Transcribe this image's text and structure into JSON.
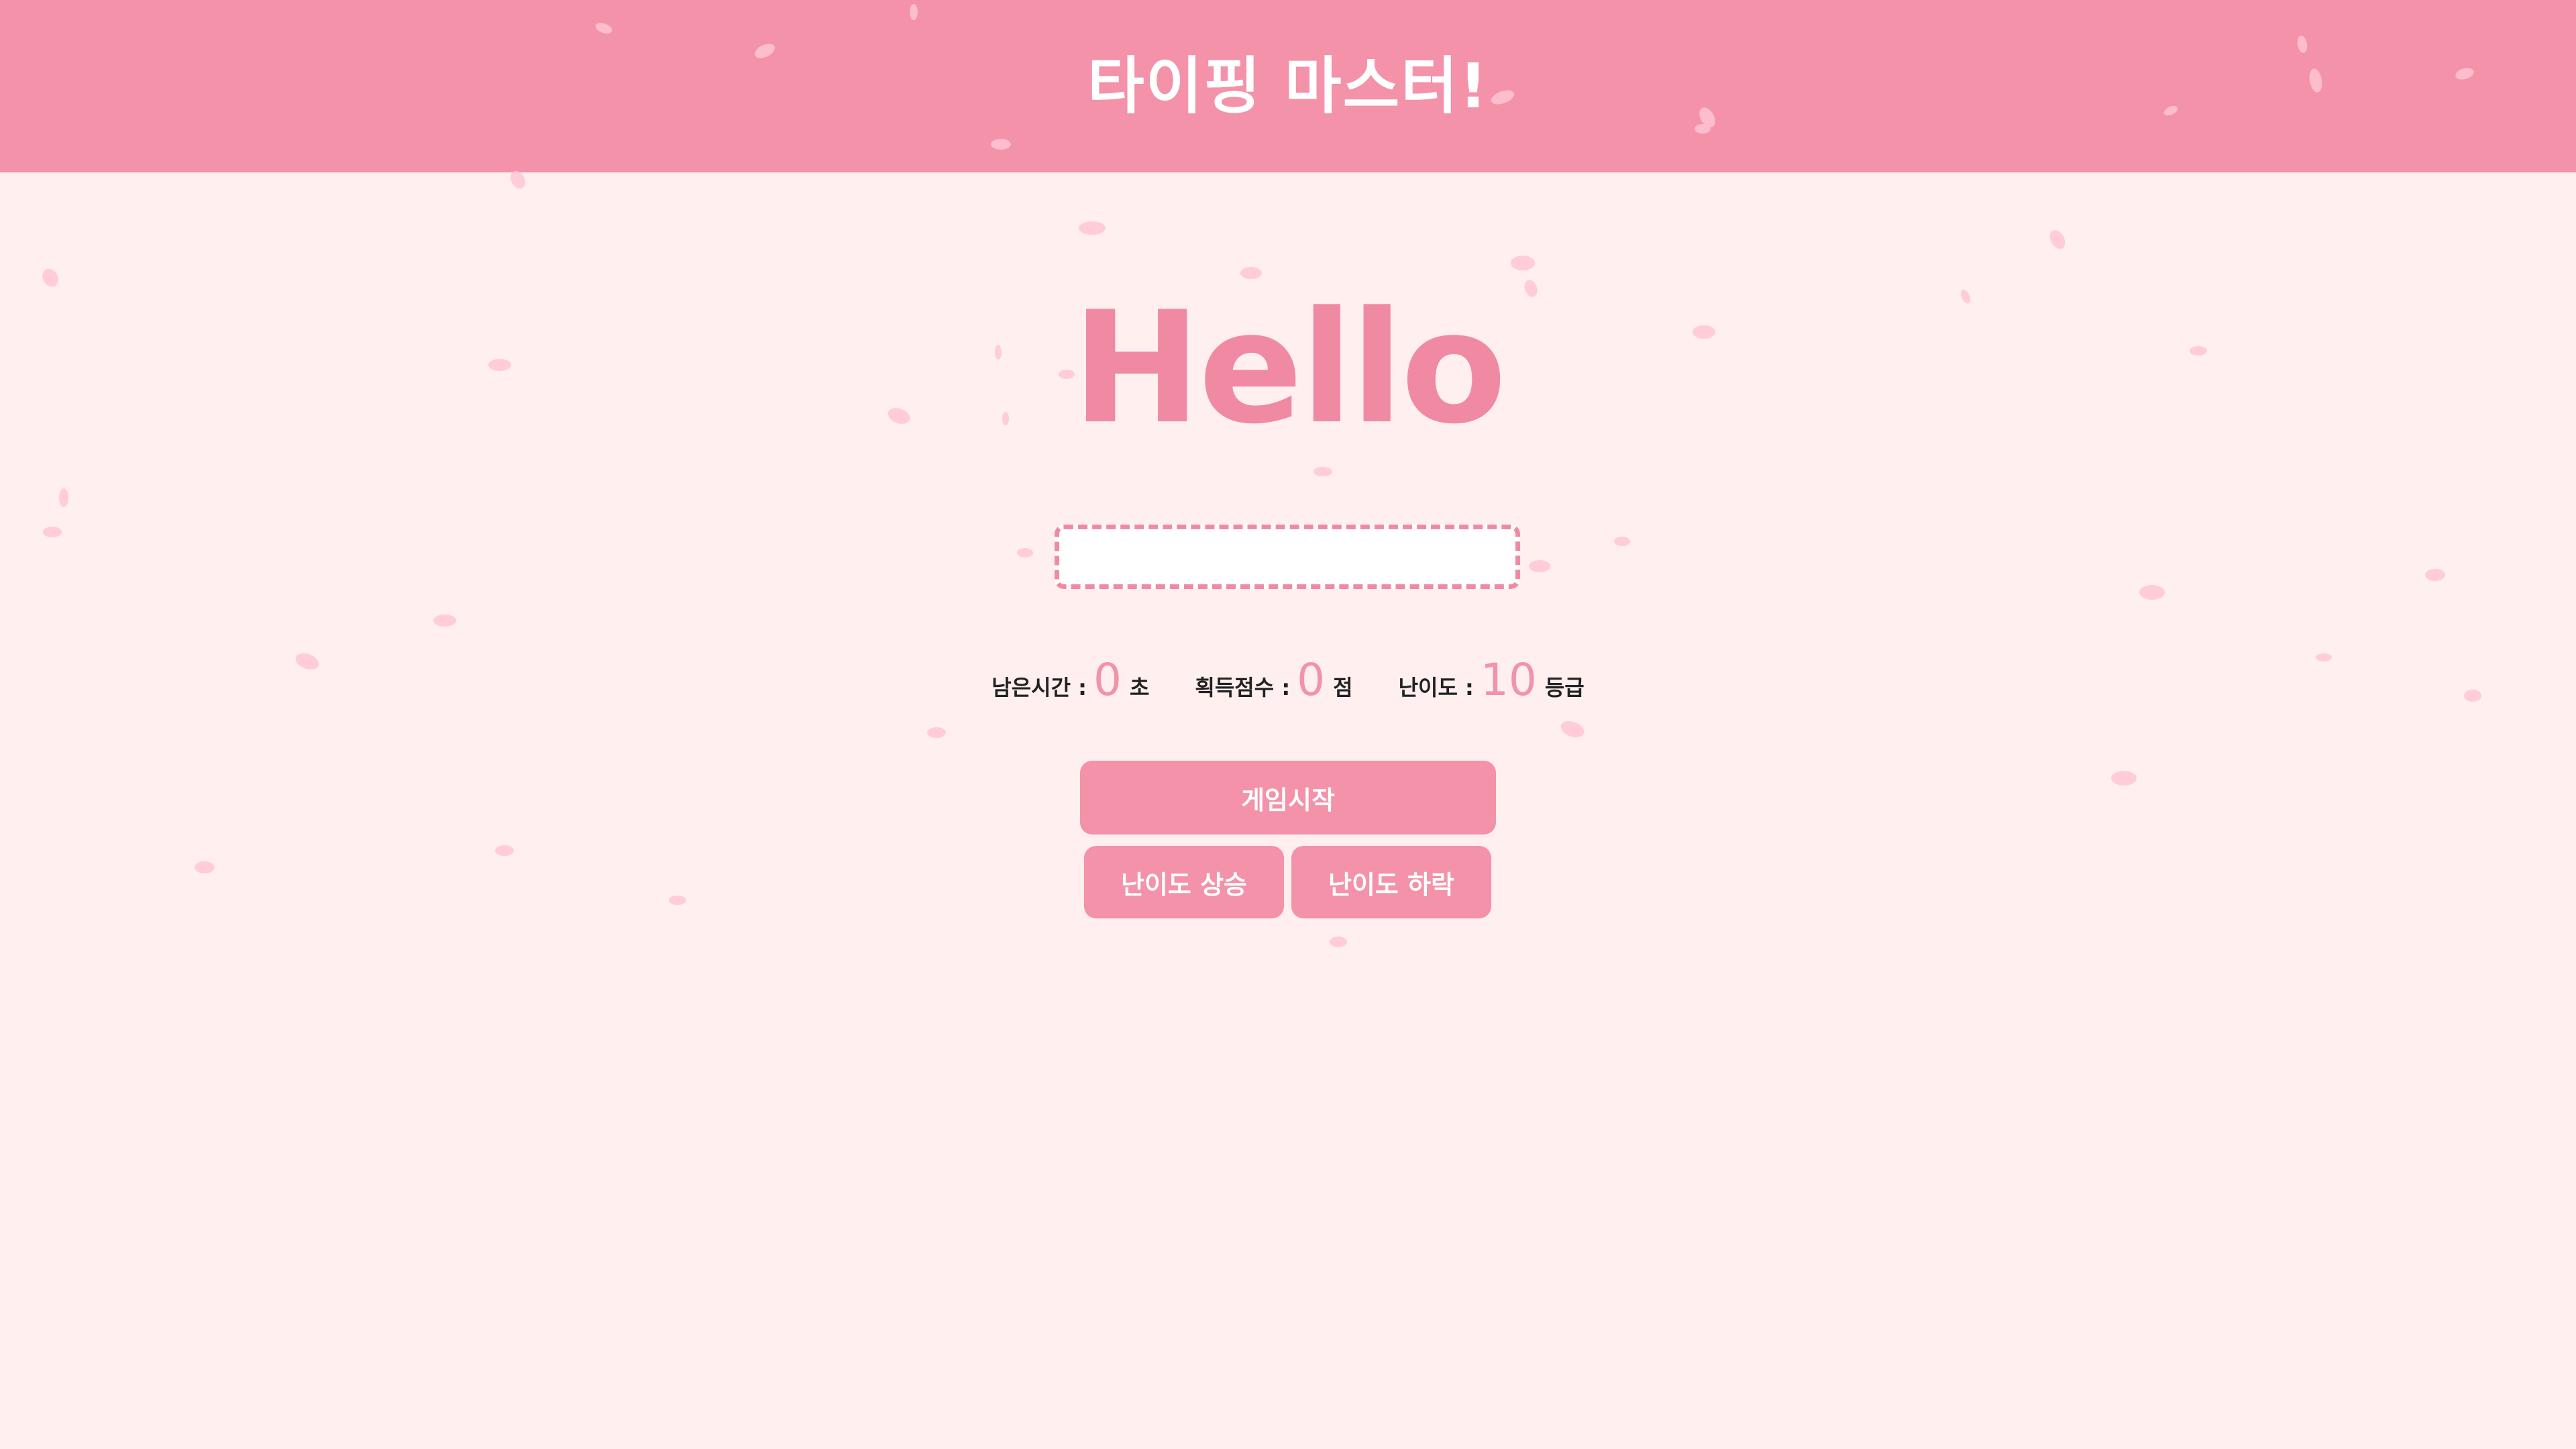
{
  "header": {
    "title": "타이핑 마스터!"
  },
  "game": {
    "current_word": "Hello",
    "input_value": ""
  },
  "stats": {
    "time_label": "남은시간 :",
    "time_value": "0",
    "time_unit": "초",
    "score_label": "획득점수 :",
    "score_value": "0",
    "score_unit": "점",
    "level_label": "난이도 :",
    "level_value": "10",
    "level_unit": "등급"
  },
  "buttons": {
    "start_label": "게임시작",
    "level_up_label": "난이도 상승",
    "level_down_label": "난이도 하락"
  },
  "colors": {
    "header_bg": "#f392a8",
    "page_bg": "#ffefef",
    "accent": "#f08aa3",
    "petal": "#ffc6d3"
  }
}
